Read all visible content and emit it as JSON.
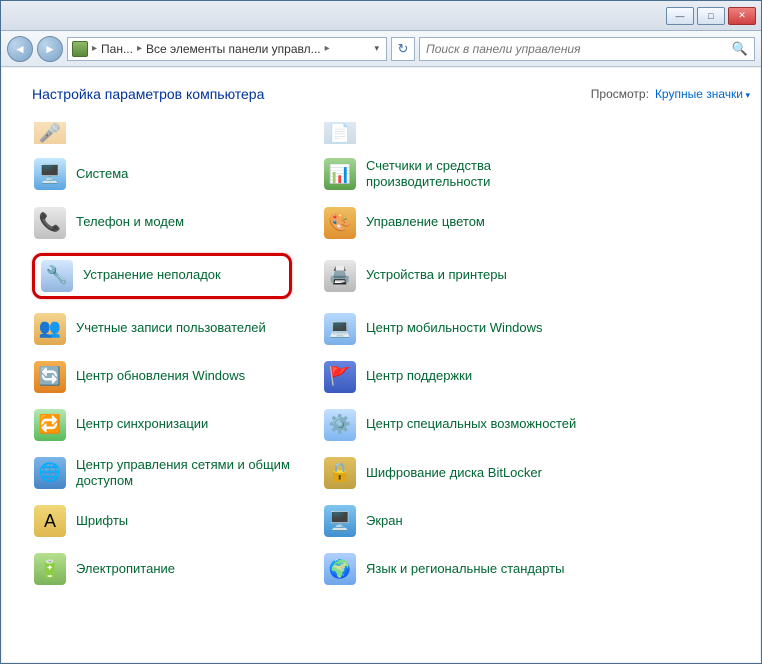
{
  "titlebar": {
    "minimize": "—",
    "maximize": "□",
    "close": "✕"
  },
  "nav": {
    "back": "◄",
    "forward": "►",
    "crumb1": "Пан...",
    "crumb2": "Все элементы панели управл...",
    "refresh": "↻",
    "search_placeholder": "Поиск в панели управления",
    "search_icon": "🔍"
  },
  "heading": "Настройка параметров компьютера",
  "view_label": "Просмотр:",
  "view_value": "Крупные значки",
  "items": [
    {
      "key": "speech",
      "label": ""
    },
    {
      "key": "blank",
      "label": ""
    },
    {
      "key": "system",
      "label": "Система"
    },
    {
      "key": "perf",
      "label": "Счетчики и средства производительности"
    },
    {
      "key": "phone",
      "label": "Телефон и модем"
    },
    {
      "key": "color",
      "label": "Управление цветом"
    },
    {
      "key": "trouble",
      "label": "Устранение неполадок"
    },
    {
      "key": "devices",
      "label": "Устройства и принтеры"
    },
    {
      "key": "users",
      "label": "Учетные записи пользователей"
    },
    {
      "key": "mobility",
      "label": "Центр мобильности Windows"
    },
    {
      "key": "update",
      "label": "Центр обновления Windows"
    },
    {
      "key": "support",
      "label": "Центр поддержки"
    },
    {
      "key": "sync",
      "label": "Центр синхронизации"
    },
    {
      "key": "access",
      "label": "Центр специальных возможностей"
    },
    {
      "key": "network",
      "label": "Центр управления сетями и общим доступом"
    },
    {
      "key": "bitlocker",
      "label": "Шифрование диска BitLocker"
    },
    {
      "key": "fonts",
      "label": "Шрифты"
    },
    {
      "key": "screen",
      "label": "Экран"
    },
    {
      "key": "power",
      "label": "Электропитание"
    },
    {
      "key": "region",
      "label": "Язык и региональные стандарты"
    }
  ]
}
